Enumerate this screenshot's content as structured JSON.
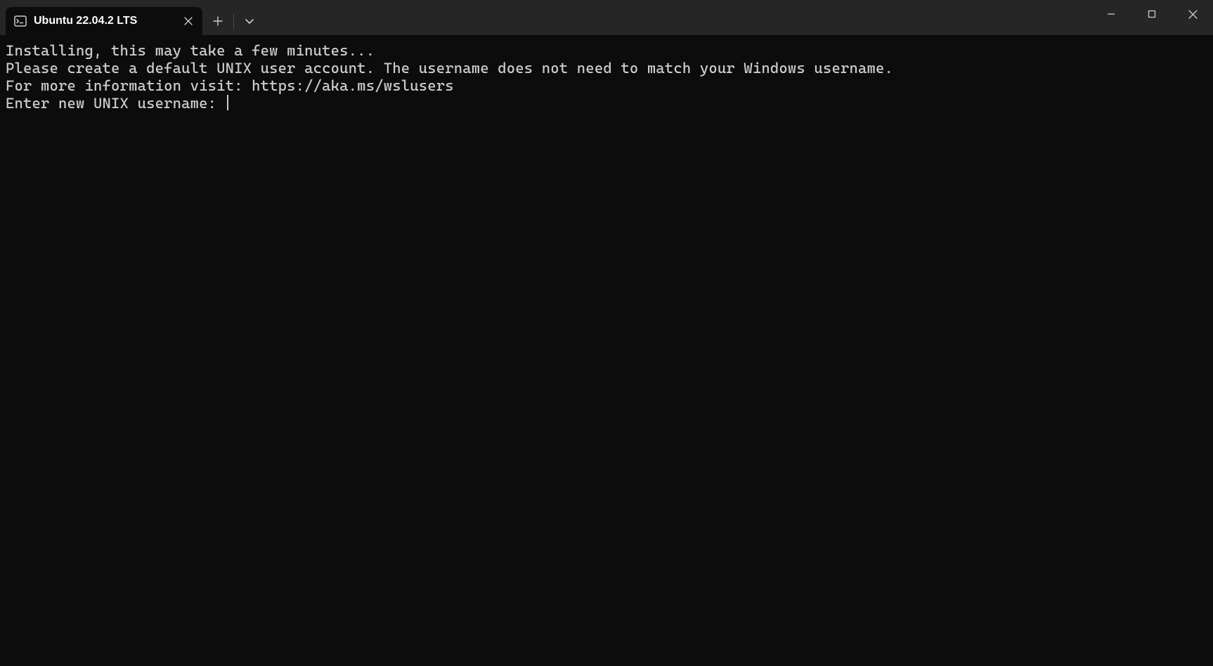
{
  "title_bar": {
    "tab": {
      "title": "Ubuntu 22.04.2 LTS",
      "icon_name": "terminal-icon"
    }
  },
  "terminal": {
    "lines": [
      "Installing, this may take a few minutes...",
      "Please create a default UNIX user account. The username does not need to match your Windows username.",
      "For more information visit: https://aka.ms/wslusers",
      "Enter new UNIX username: "
    ]
  }
}
